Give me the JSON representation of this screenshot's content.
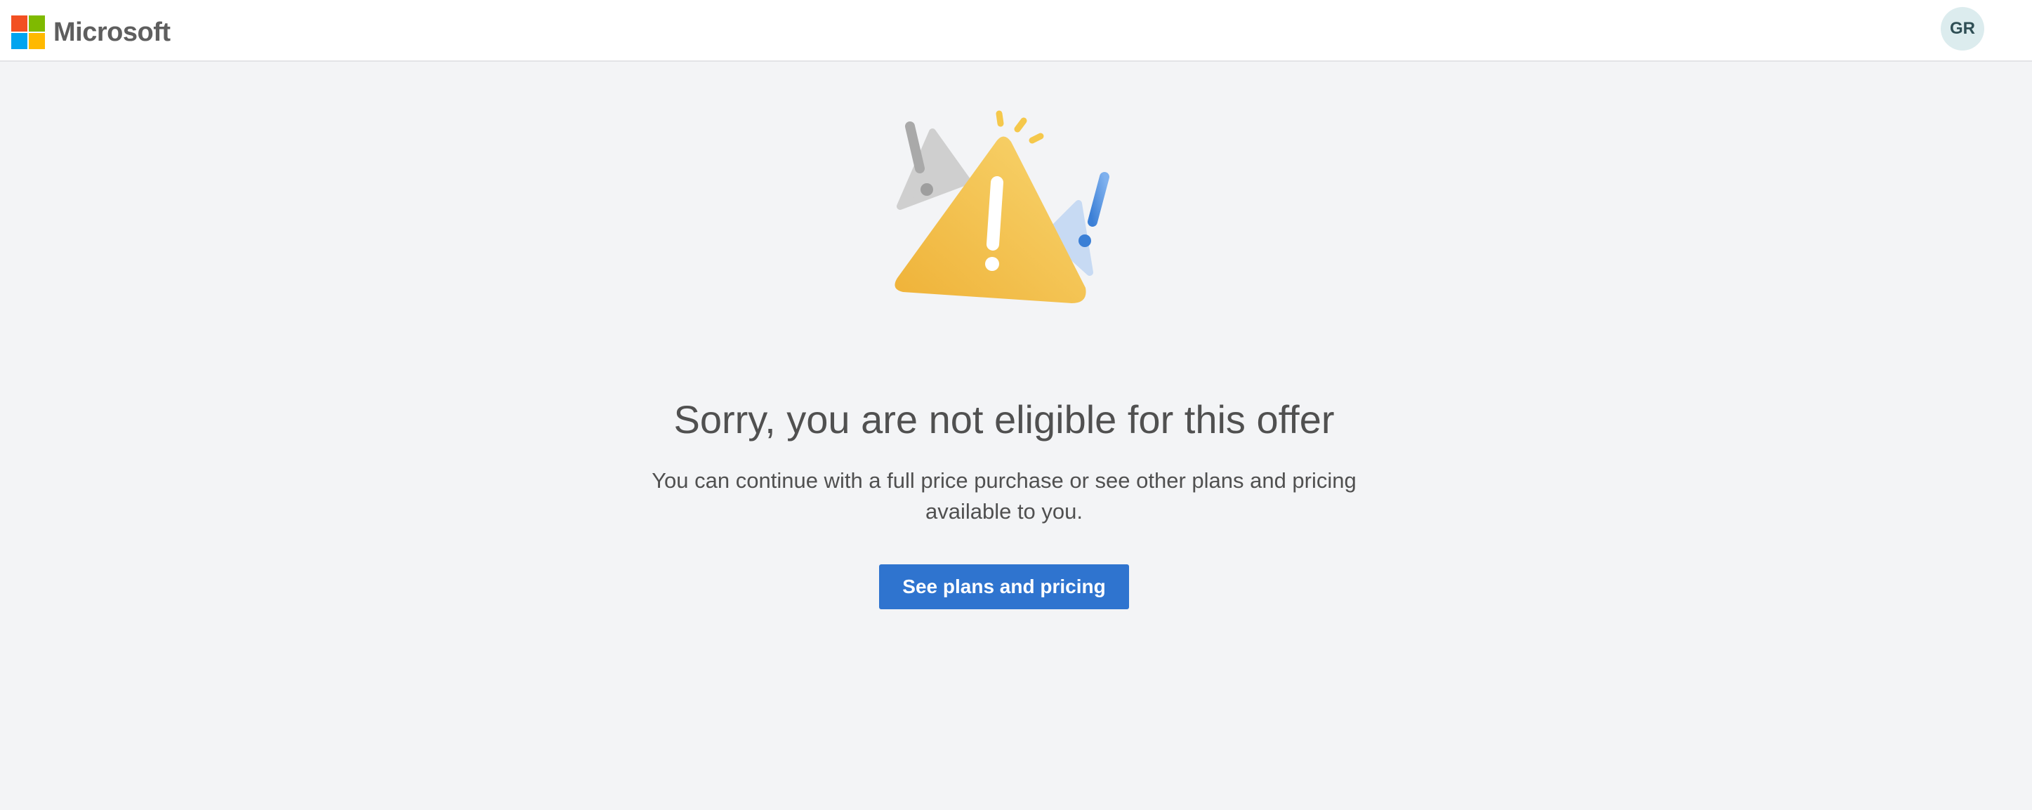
{
  "header": {
    "brand": "Microsoft",
    "avatar_initials": "GR",
    "logo_colors": [
      "#f25022",
      "#7fba00",
      "#00a4ef",
      "#ffb900"
    ]
  },
  "main": {
    "illustration_icon": "warning-triangle-icon",
    "headline": "Sorry, you are not eligible for this offer",
    "subtext": "You can continue with a full price purchase or see other plans and pricing available to you.",
    "cta_label": "See plans and pricing"
  },
  "colors": {
    "page_background": "#f3f4f6",
    "primary_button": "#2f74cf",
    "warning_yellow": "#f3b93c"
  }
}
